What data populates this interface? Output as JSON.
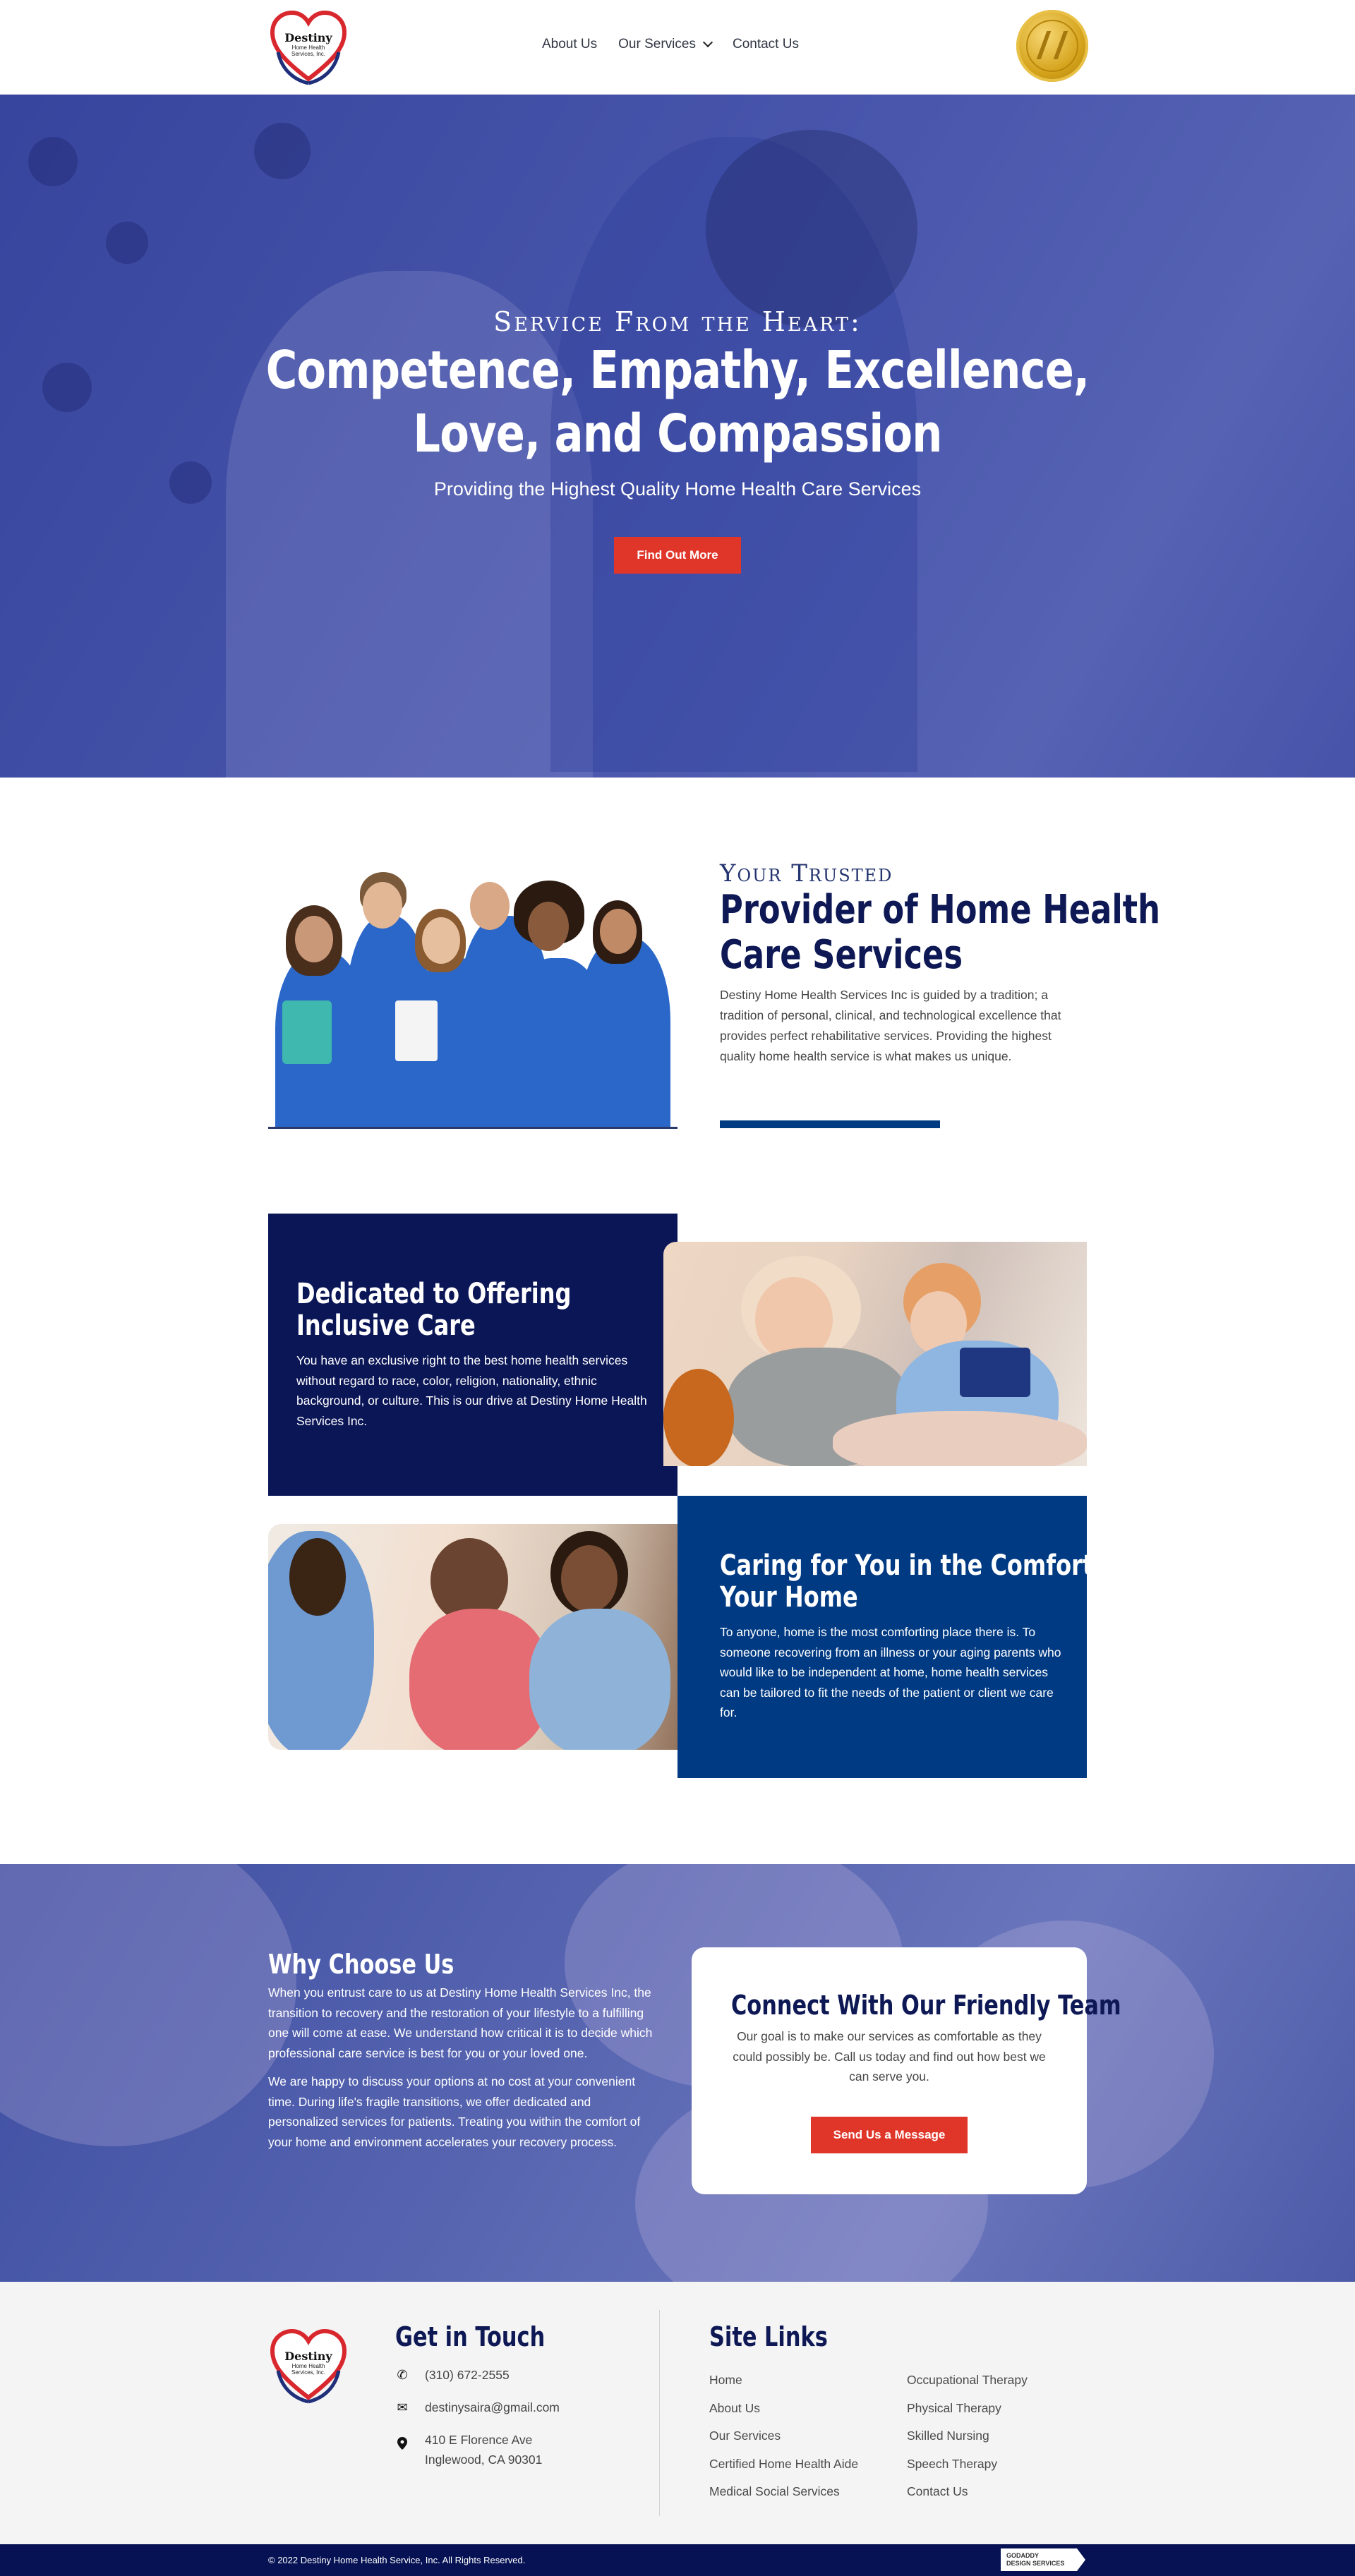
{
  "brand": {
    "logo_line1": "Destiny",
    "logo_line2": "Home Health",
    "logo_line3": "Services, Inc.",
    "colors": {
      "navy": "#0b1657",
      "blue": "#003a83",
      "red": "#e0362a",
      "heart_red": "#d9272e"
    }
  },
  "nav": {
    "items": [
      {
        "label": "About Us",
        "dropdown": false
      },
      {
        "label": "Our Services",
        "dropdown": true
      },
      {
        "label": "Contact Us",
        "dropdown": false
      }
    ]
  },
  "hero": {
    "kicker": "Service From the Heart:",
    "title_line1": "Competence, Empathy, Excellence,",
    "title_line2": "Love, and Compassion",
    "subtitle": "Providing the Highest Quality Home Health Care Services",
    "button": "Find Out More"
  },
  "trusted": {
    "kicker": "Your Trusted",
    "title_line1": "Provider of Home Health",
    "title_line2": "Care Services",
    "body": "Destiny Home Health Services Inc is guided by a tradition; a tradition of personal, clinical, and technological excellence that provides perfect rehabilitative services. Providing the highest quality home health service is what makes us unique."
  },
  "inclusive": {
    "title_line1": "Dedicated to Offering",
    "title_line2": "Inclusive Care",
    "body": "You have an exclusive right to the best home health services without regard to race, color, religion, nationality, ethnic background, or culture. This is our drive at Destiny Home Health Services Inc."
  },
  "comfort": {
    "title_line1": "Caring for You in the Comfort of",
    "title_line2": "Your Home",
    "body": "To anyone, home is the most comforting place there is. To someone recovering from an illness or your aging parents who would like to be independent at home, home health services can be tailored to fit the needs of the patient or client we care for."
  },
  "why": {
    "title": "Why Choose Us",
    "para1": "When you entrust care to us at Destiny Home Health Services Inc, the transition to recovery and the restoration of your lifestyle to a fulfilling one will come at ease. We understand how critical it is to decide which professional care service is best for you or your loved one.",
    "para2": "We are happy to discuss your options at no cost at your convenient time. During life's fragile transitions, we offer dedicated and personalized services for patients. Treating you within the comfort of your home and environment accelerates your recovery process."
  },
  "connect": {
    "title": "Connect With Our Friendly Team",
    "body": "Our goal is to make our services as comfortable as they could possibly be. Call us today and find out how best we can serve you.",
    "button": "Send Us a Message"
  },
  "footer": {
    "touch_title": "Get in Touch",
    "phone": "(310) 672-2555",
    "email": "destinysaira@gmail.com",
    "address_line1": "410 E Florence Ave",
    "address_line2": "Inglewood, CA 90301",
    "links_title": "Site Links",
    "links_col1": [
      "Home",
      "About Us",
      "Our Services",
      "Certified Home Health Aide",
      "Medical Social Services"
    ],
    "links_col2": [
      "Occupational Therapy",
      "Physical Therapy",
      "Skilled Nursing",
      "Speech Therapy",
      "Contact Us"
    ],
    "copyright": "© 2022 Destiny Home Health Service, Inc. All Rights Reserved.",
    "badge_line1": "GODADDY",
    "badge_line2": "DESIGN SERVICES"
  }
}
